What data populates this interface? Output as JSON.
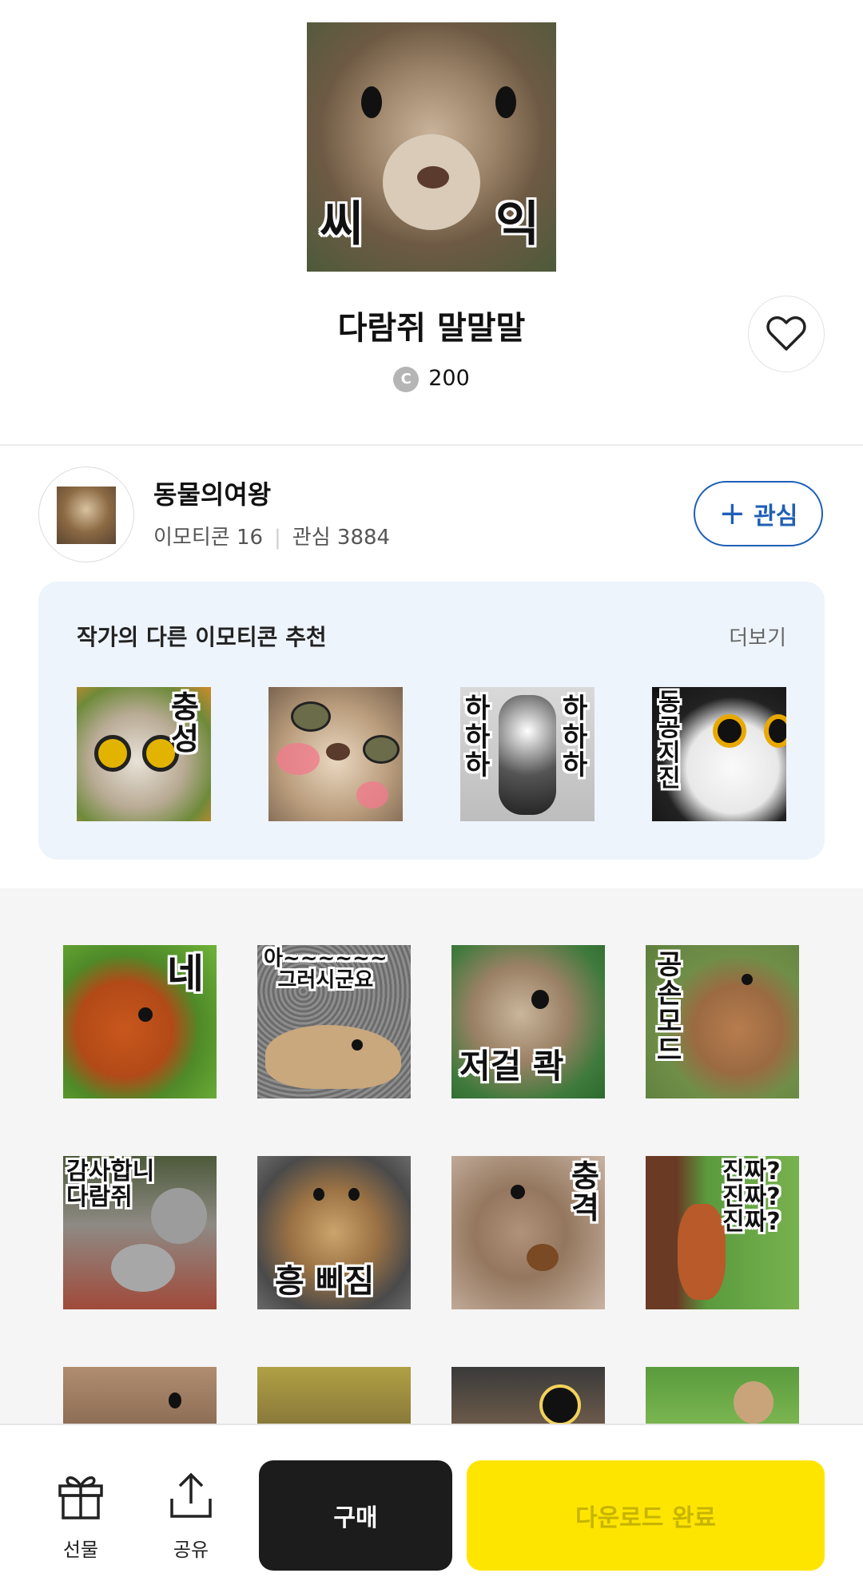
{
  "emoticon": {
    "hero_overlay_left": "씨",
    "hero_overlay_right": "익",
    "title": "다람쥐 말말말",
    "coin_symbol": "C",
    "price": "200"
  },
  "author": {
    "name": "동물의여왕",
    "emoticon_count": "이모티콘 16",
    "separator": "|",
    "followers": "관심 3884",
    "follow_button": "관심",
    "follow_plus": "+"
  },
  "recommend": {
    "title": "작가의 다른 이모티콘 추천",
    "more": "더보기",
    "items": [
      {
        "text": "충\n성"
      },
      {
        "text": ""
      },
      {
        "text_left": "하\n하\n하",
        "text_right": "하\n하\n하"
      },
      {
        "text": "동\n공\n지\n진"
      }
    ]
  },
  "grid": {
    "row1": [
      "네",
      "아~~~~~~\n그러시군요",
      "저걸 콱",
      "공\n손\n모\n드"
    ],
    "row2": [
      "감사합니\n다람쥐",
      "흥 삐짐",
      "충\n격",
      "진짜?\n진짜?\n진짜?"
    ]
  },
  "bottom_bar": {
    "gift_label": "선물",
    "share_label": "공유",
    "buy_label": "구매",
    "download_label": "다운로드 완료"
  },
  "colors": {
    "accent_blue": "#1f5fb6",
    "download_yellow": "#fee500",
    "buy_black": "#1c1c1c",
    "rec_bg": "#eef4fc"
  }
}
